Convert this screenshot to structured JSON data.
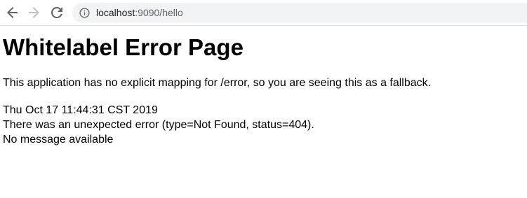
{
  "browser": {
    "url_host": "localhost",
    "url_rest": ":9090/hello",
    "icons": {
      "back": "arrow-left-icon",
      "forward": "arrow-right-icon",
      "reload": "reload-icon",
      "info": "info-circle-icon"
    }
  },
  "page": {
    "title": "Whitelabel Error Page",
    "fallback_text": "This application has no explicit mapping for /error, so you are seeing this as a fallback.",
    "timestamp": "Thu Oct 17 11:44:31 CST 2019",
    "error_line": "There was an unexpected error (type=Not Found, status=404).",
    "message_line": "No message available"
  }
}
